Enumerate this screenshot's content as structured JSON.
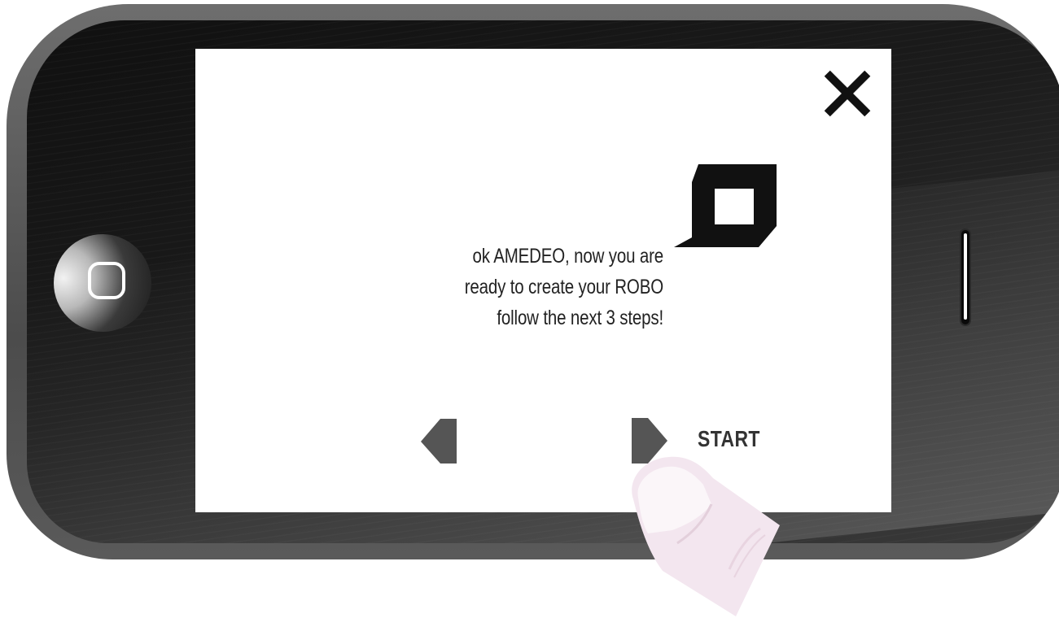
{
  "screen": {
    "message_lines": [
      "ok AMEDEO, now you are",
      "ready to create your ROBO",
      "follow the next 3 steps!"
    ],
    "start_label": "START"
  },
  "icons": {
    "close": "close-icon",
    "prev": "arrow-left-icon",
    "next": "arrow-right-icon",
    "logo": "robo-logo",
    "home": "home-button-icon",
    "pointer": "finger-tap-icon"
  },
  "colors": {
    "screen_bg": "#ffffff",
    "phone_frame": "#5a5a5a",
    "text": "#222222",
    "arrows": "#555555",
    "finger": "#f3e6ef"
  }
}
